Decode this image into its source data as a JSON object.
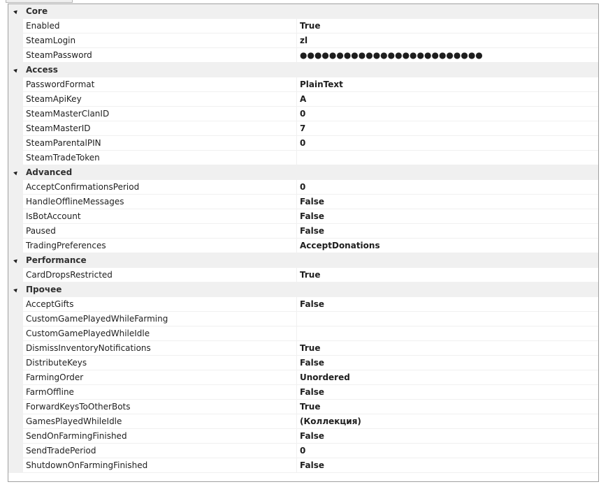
{
  "categories": [
    {
      "label": "Core",
      "props": [
        {
          "name": "Enabled",
          "value": "True"
        },
        {
          "name": "SteamLogin",
          "value": "zl"
        },
        {
          "name": "SteamPassword",
          "value": "●●●●●●●●●●●●●●●●●●●●●●●●●"
        }
      ]
    },
    {
      "label": "Access",
      "props": [
        {
          "name": "PasswordFormat",
          "value": "PlainText"
        },
        {
          "name": "SteamApiKey",
          "value": "A"
        },
        {
          "name": "SteamMasterClanID",
          "value": "0"
        },
        {
          "name": "SteamMasterID",
          "value": "7"
        },
        {
          "name": "SteamParentalPIN",
          "value": "0"
        },
        {
          "name": "SteamTradeToken",
          "value": ""
        }
      ]
    },
    {
      "label": "Advanced",
      "props": [
        {
          "name": "AcceptConfirmationsPeriod",
          "value": "0"
        },
        {
          "name": "HandleOfflineMessages",
          "value": "False"
        },
        {
          "name": "IsBotAccount",
          "value": "False"
        },
        {
          "name": "Paused",
          "value": "False"
        },
        {
          "name": "TradingPreferences",
          "value": "AcceptDonations"
        }
      ]
    },
    {
      "label": "Performance",
      "props": [
        {
          "name": "CardDropsRestricted",
          "value": "True"
        }
      ]
    },
    {
      "label": "Прочее",
      "props": [
        {
          "name": "AcceptGifts",
          "value": "False"
        },
        {
          "name": "CustomGamePlayedWhileFarming",
          "value": ""
        },
        {
          "name": "CustomGamePlayedWhileIdle",
          "value": ""
        },
        {
          "name": "DismissInventoryNotifications",
          "value": "True"
        },
        {
          "name": "DistributeKeys",
          "value": "False"
        },
        {
          "name": "FarmingOrder",
          "value": "Unordered"
        },
        {
          "name": "FarmOffline",
          "value": "False"
        },
        {
          "name": "ForwardKeysToOtherBots",
          "value": "True"
        },
        {
          "name": "GamesPlayedWhileIdle",
          "value": "(Коллекция)"
        },
        {
          "name": "SendOnFarmingFinished",
          "value": "False"
        },
        {
          "name": "SendTradePeriod",
          "value": "0"
        },
        {
          "name": "ShutdownOnFarmingFinished",
          "value": "False"
        }
      ]
    }
  ],
  "icons": {
    "expander": "expanded-triangle-icon"
  },
  "colors": {
    "category_background": "#f0f0f0",
    "border": "#a0a0a0",
    "grid_line": "#f0f0f0"
  }
}
